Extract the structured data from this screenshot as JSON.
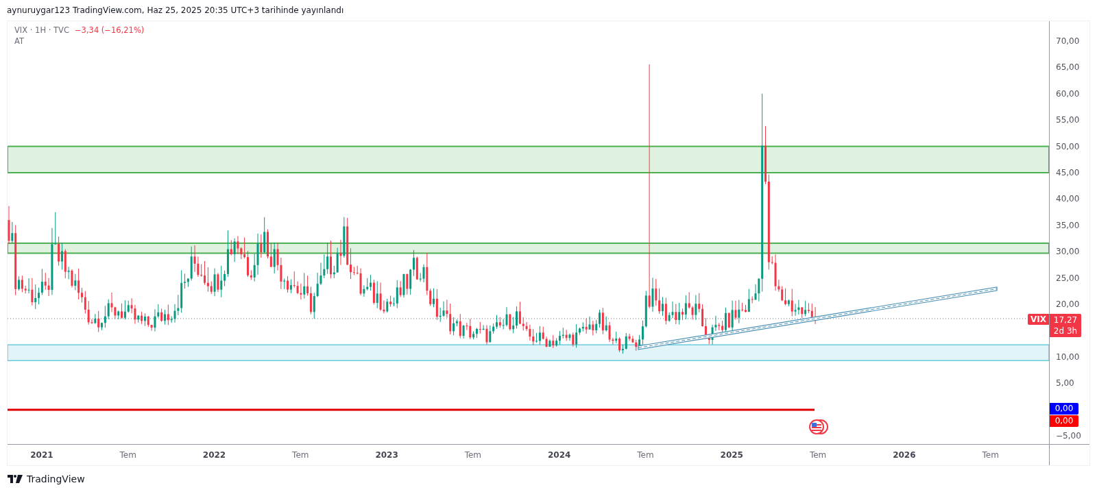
{
  "header": {
    "text": "aynuruygar123 TradingView.com, Haz 25, 2025 20:35 UTC+3 tarihinde yayınlandı"
  },
  "legend": {
    "symbol": "VIX · 1H · TVC",
    "change": "−3,34 (−16,21%)",
    "line_2": "AT"
  },
  "price_axis": {
    "upper": [
      "70,00",
      "65,00",
      "60,00",
      "55,00",
      "50,00",
      "45,00",
      "40,00",
      "35,00",
      "30,00",
      "25,00",
      "20,00"
    ],
    "lower": [
      "10,00",
      "5,00"
    ],
    "bottom": [
      "−5,00"
    ]
  },
  "last_price": {
    "symbol": "VIX",
    "price": "17,27",
    "countdown": "2d 3h"
  },
  "indicator_badges": [
    {
      "value": "0,00",
      "color": "#0000ff"
    },
    {
      "value": "0,00",
      "color": "#ff0000"
    }
  ],
  "time_axis": [
    {
      "label": "2021",
      "kind": "year"
    },
    {
      "label": "Tem",
      "kind": "month"
    },
    {
      "label": "2022",
      "kind": "year"
    },
    {
      "label": "Tem",
      "kind": "month"
    },
    {
      "label": "2023",
      "kind": "year"
    },
    {
      "label": "Tem",
      "kind": "month"
    },
    {
      "label": "2024",
      "kind": "year"
    },
    {
      "label": "Tem",
      "kind": "month"
    },
    {
      "label": "2025",
      "kind": "year"
    },
    {
      "label": "Tem",
      "kind": "month"
    },
    {
      "label": "2026",
      "kind": "year"
    },
    {
      "label": "Tem",
      "kind": "month"
    }
  ],
  "footer": {
    "brand": "TradingView"
  }
}
